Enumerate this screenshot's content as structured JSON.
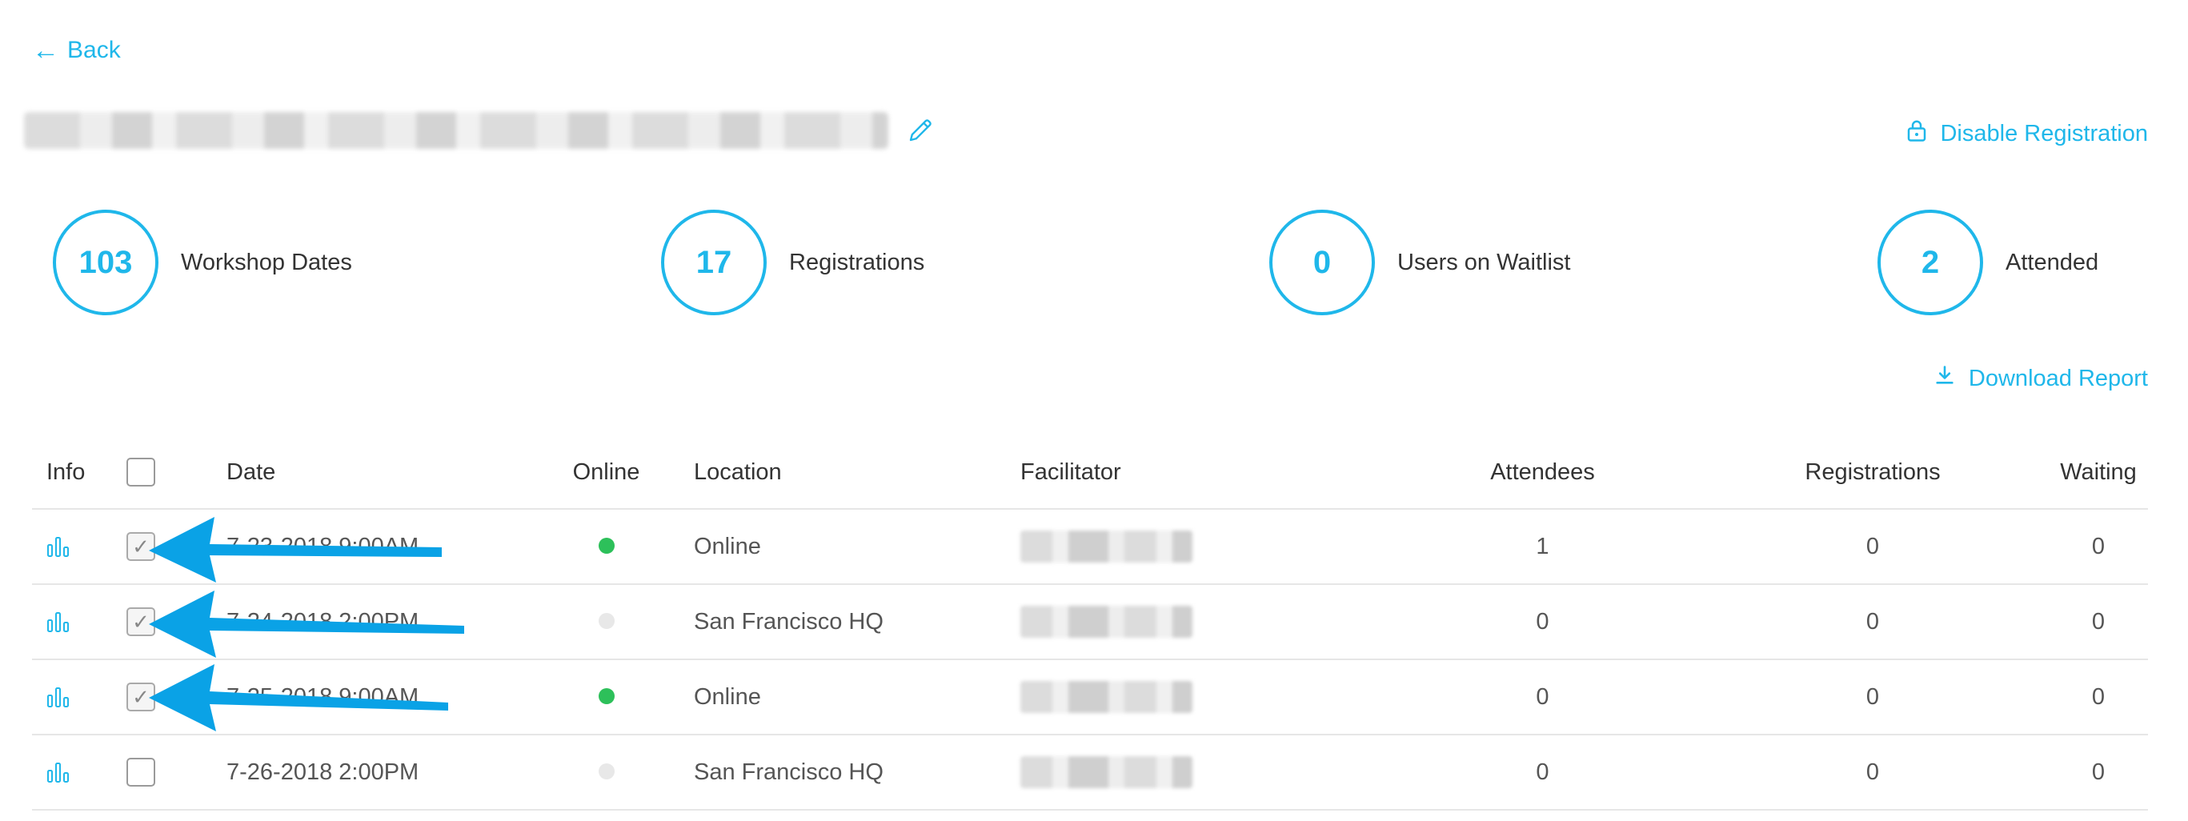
{
  "nav": {
    "back_label": "Back"
  },
  "actions": {
    "disable_registration": "Disable Registration",
    "download_report": "Download Report"
  },
  "stats": [
    {
      "value": "103",
      "label": "Workshop Dates"
    },
    {
      "value": "17",
      "label": "Registrations"
    },
    {
      "value": "0",
      "label": "Users on Waitlist"
    },
    {
      "value": "2",
      "label": "Attended"
    }
  ],
  "table": {
    "headers": {
      "info": "Info",
      "date": "Date",
      "online": "Online",
      "location": "Location",
      "facilitator": "Facilitator",
      "attendees": "Attendees",
      "registrations": "Registrations",
      "waiting": "Waiting"
    },
    "rows": [
      {
        "date": "7-23-2018 9:00AM",
        "online": true,
        "location": "Online",
        "attendees": "1",
        "registrations": "0",
        "waiting": "0",
        "checked": true
      },
      {
        "date": "7-24-2018 2:00PM",
        "online": false,
        "location": "San Francisco HQ",
        "attendees": "0",
        "registrations": "0",
        "waiting": "0",
        "checked": true
      },
      {
        "date": "7-25-2018 9:00AM",
        "online": true,
        "location": "Online",
        "attendees": "0",
        "registrations": "0",
        "waiting": "0",
        "checked": true
      },
      {
        "date": "7-26-2018 2:00PM",
        "online": false,
        "location": "San Francisco HQ",
        "attendees": "0",
        "registrations": "0",
        "waiting": "0",
        "checked": false
      }
    ]
  },
  "colors": {
    "accent": "#1fb7ea",
    "online_dot": "#2dc05a",
    "offline_dot": "#e8e8e8",
    "annotation_arrow": "#0aa2e6"
  }
}
